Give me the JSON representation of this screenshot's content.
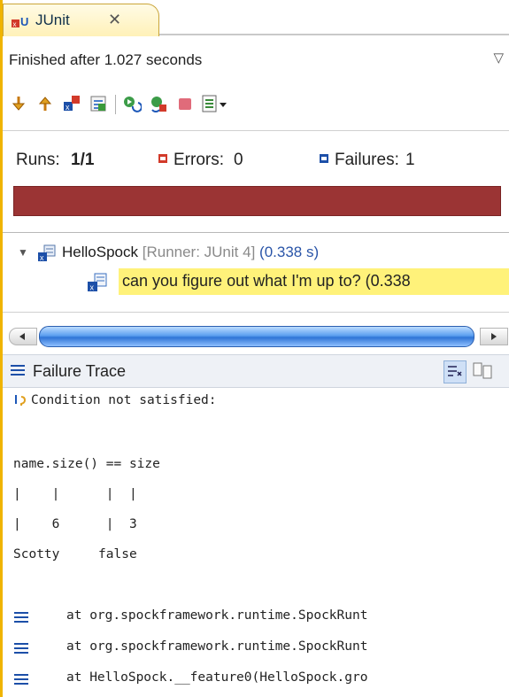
{
  "view": {
    "tab_title": "JUnit",
    "tab_close_icon": "close-icon",
    "status": "Finished after 1.027 seconds",
    "view_menu_icon": "view-menu-chevron"
  },
  "toolbar": {
    "icons": [
      "next-failure-icon",
      "previous-failure-icon",
      "show-failures-only-icon",
      "scroll-lock-icon",
      "rerun-icon",
      "rerun-failed-first-icon",
      "stop-icon",
      "history-icon",
      "history-dropdown-icon"
    ]
  },
  "counters": {
    "runs_label": "Runs:",
    "runs_value": "1/1",
    "errors_label": "Errors:",
    "errors_value": "0",
    "failures_label": "Failures:",
    "failures_value": "1"
  },
  "progress": {
    "fraction": 1.0,
    "color": "#9b3434",
    "status": "failed"
  },
  "tree": {
    "suite_name": "HelloSpock",
    "suite_runner": "[Runner: JUnit 4]",
    "suite_time": "(0.338 s)",
    "test_name": "can you figure out what I'm up to?",
    "test_time": "(0.338"
  },
  "trace": {
    "title": "Failure Trace",
    "lines": [
      "Condition not satisfied:",
      "",
      "name.size() == size",
      "|    |      |  |",
      "|    6      |  3",
      "Scotty     false"
    ],
    "stack": [
      "at org.spockframework.runtime.SpockRunt",
      "at org.spockframework.runtime.SpockRunt",
      "at HelloSpock.__feature0(HelloSpock.gro"
    ]
  },
  "colors": {
    "accent_bar": "#f0b400",
    "failure_bar": "#9b3434",
    "highlight": "#fff27a",
    "link_blue": "#2a55a8"
  }
}
